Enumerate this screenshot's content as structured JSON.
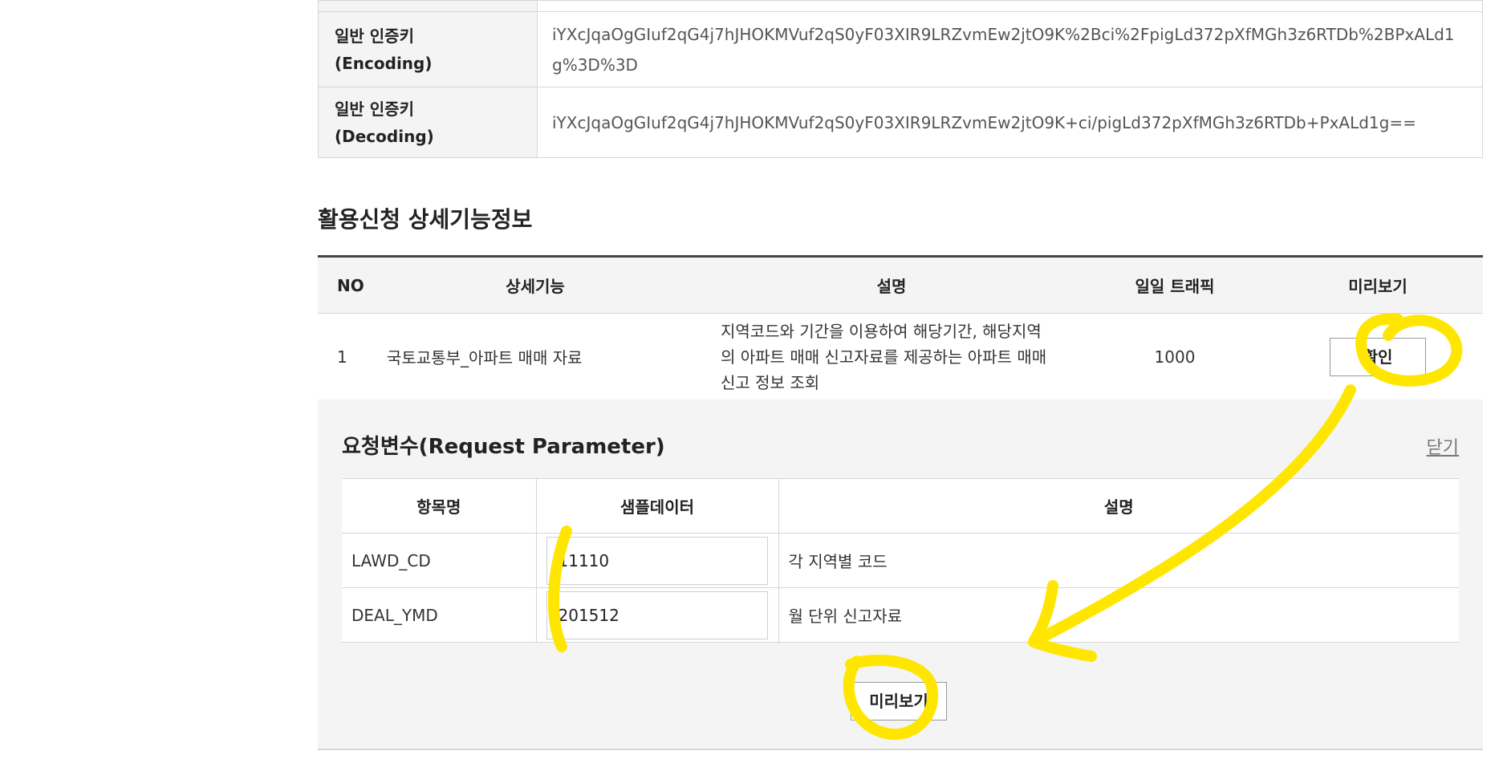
{
  "auth_keys": [
    {
      "label_line1": "일반 인증키",
      "label_line2": "(Encoding)",
      "value": "iYXcJqaOgGIuf2qG4j7hJHOKMVuf2qS0yF03XIR9LRZvmEw2jtO9K%2Bci%2FpigLd372pXfMGh3z6RTDb%2BPxALd1g%3D%3D"
    },
    {
      "label_line1": "일반 인증키",
      "label_line2": "(Decoding)",
      "value": "iYXcJqaOgGIuf2qG4j7hJHOKMVuf2qS0yF03XIR9LRZvmEw2jtO9K+ci/pigLd372pXfMGh3z6RTDb+PxALd1g=="
    }
  ],
  "section_title": "활용신청 상세기능정보",
  "function_table": {
    "headers": {
      "no": "NO",
      "function": "상세기능",
      "description": "설명",
      "daily_traffic": "일일 트래픽",
      "preview": "미리보기"
    },
    "rows": [
      {
        "no": "1",
        "function": "국토교통부_아파트 매매 자료",
        "description_lines": [
          "지역코드와 기간을 이용하여 해당기간, 해당지역",
          "의 아파트 매매 신고자료를 제공하는 아파트 매매",
          "신고 정보 조회"
        ],
        "daily_traffic": "1000",
        "button": "확인"
      }
    ]
  },
  "request_parameter": {
    "title": "요청변수(Request Parameter)",
    "close_label": "닫기",
    "headers": {
      "name": "항목명",
      "sample": "샘플데이터",
      "description": "설명"
    },
    "rows": [
      {
        "name": "LAWD_CD",
        "sample": "11110",
        "description": "각 지역별 코드"
      },
      {
        "name": "DEAL_YMD",
        "sample": "201512",
        "description": "월 단위 신고자료"
      }
    ],
    "preview_button": "미리보기"
  },
  "annotation_color": "#ffe600"
}
